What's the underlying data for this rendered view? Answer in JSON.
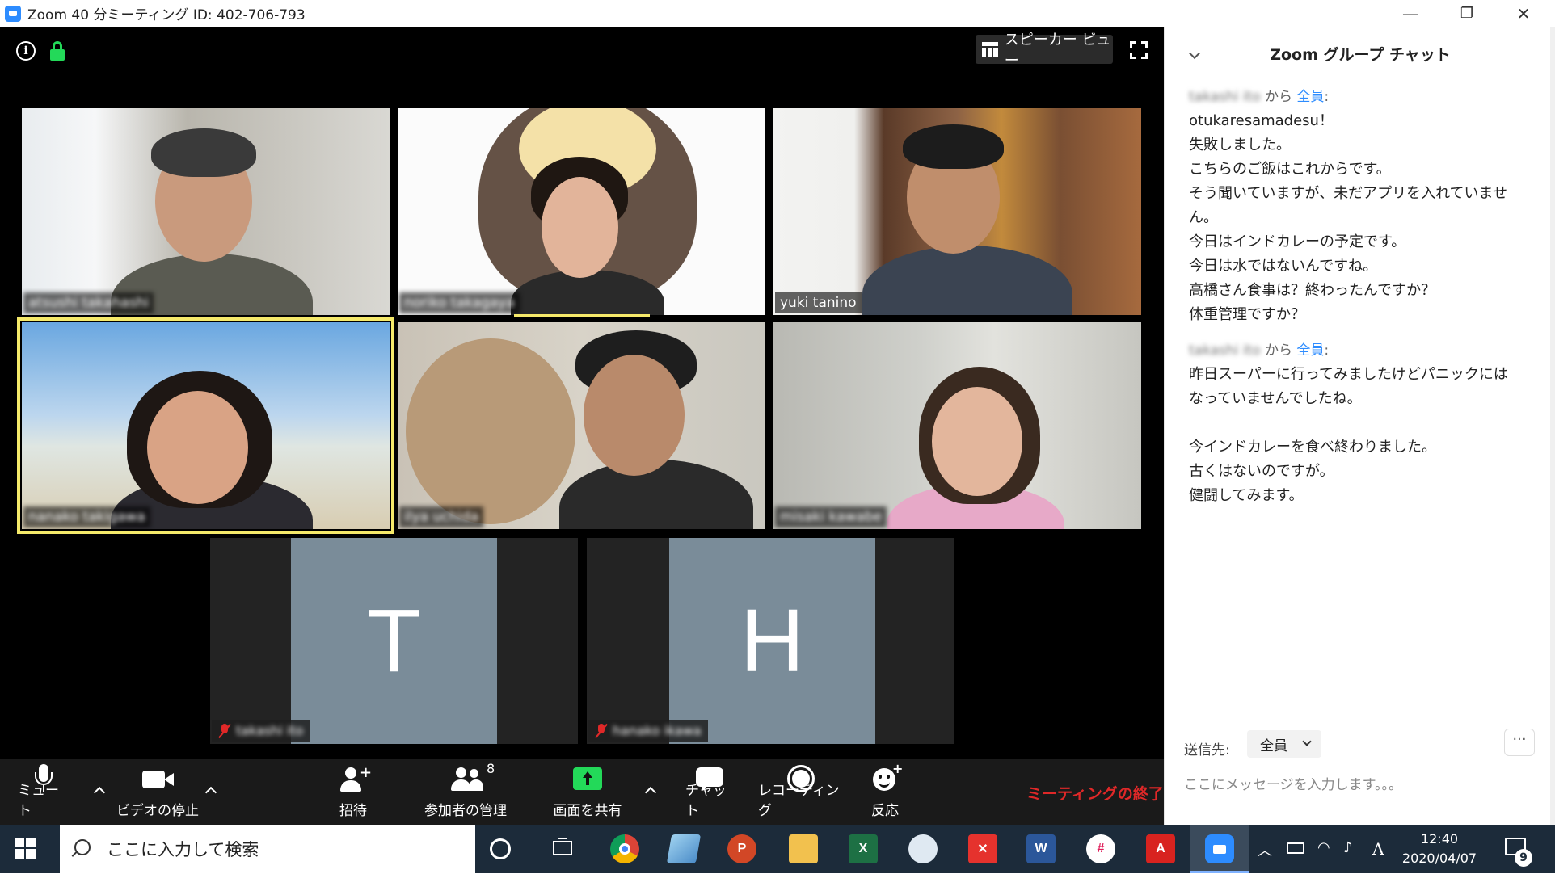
{
  "window": {
    "title": "Zoom 40 分ミーティング ID: 402-706-793",
    "minimize": "—",
    "restore": "❐",
    "close": "✕"
  },
  "meeting": {
    "view_button": "スピーカー ビュー",
    "participants": [
      {
        "name": "atsushi takahashi"
      },
      {
        "name": "noriko takagaya"
      },
      {
        "name": "yuki tanino"
      },
      {
        "name": "nanako takigawa"
      },
      {
        "name": "ilya uchida"
      },
      {
        "name": "misaki kawabe"
      },
      {
        "name": "takashi ito",
        "initial": "T",
        "muted": true
      },
      {
        "name": "hanako ikawa",
        "initial": "H",
        "muted": true
      }
    ]
  },
  "toolbar": {
    "mute": "ミュート",
    "stop_video": "ビデオの停止",
    "invite": "招待",
    "manage_participants": "参加者の管理",
    "participant_count": "8",
    "share_screen": "画面を共有",
    "chat": "チャット",
    "recording": "レコーディング",
    "reactions": "反応",
    "end_meeting": "ミーティングの終了"
  },
  "chat": {
    "title": "Zoom グループ チャット",
    "messages": [
      {
        "sender": "takashi ito",
        "from_word": "から",
        "to": "全員",
        "lines": [
          "otukaresamadesu！",
          "失敗しました。",
          "こちらのご飯はこれからです。",
          "そう聞いていますが、未だアプリを入れていませ",
          "ん。",
          "今日はインドカレーの予定です。",
          "今日は水ではないんですね。",
          "高橋さん食事は？終わったんですか？",
          "体重管理ですか？"
        ]
      },
      {
        "sender": "takashi ito",
        "from_word": "から",
        "to": "全員",
        "lines": [
          "昨日スーパーに行ってみましたけどパニックには",
          "なっていませんでしたね。",
          "",
          "今インドカレーを食べ終わりました。",
          "古くはないのですが。",
          "健闘してみます。"
        ]
      }
    ],
    "send_to_label": "送信先:",
    "recipient": "全員",
    "more": "···",
    "input_placeholder": "ここにメッセージを入力します。。。"
  },
  "taskbar": {
    "search_placeholder": "ここに入力して検索",
    "apps": [
      "chrome-icon",
      "notepad-icon",
      "powerpoint-icon",
      "file-explorer-icon",
      "excel-icon",
      "snipping-icon",
      "xmind-icon",
      "word-icon",
      "slack-icon",
      "acrobat-icon",
      "zoom-icon"
    ],
    "time": "12:40",
    "date": "2020/04/07",
    "ime": "A",
    "notification_count": "9"
  },
  "colors": {
    "zoom_blue": "#2D8CFF",
    "active_speaker": "#F5E96A",
    "end_red": "#E02828",
    "share_green": "#23D959"
  }
}
